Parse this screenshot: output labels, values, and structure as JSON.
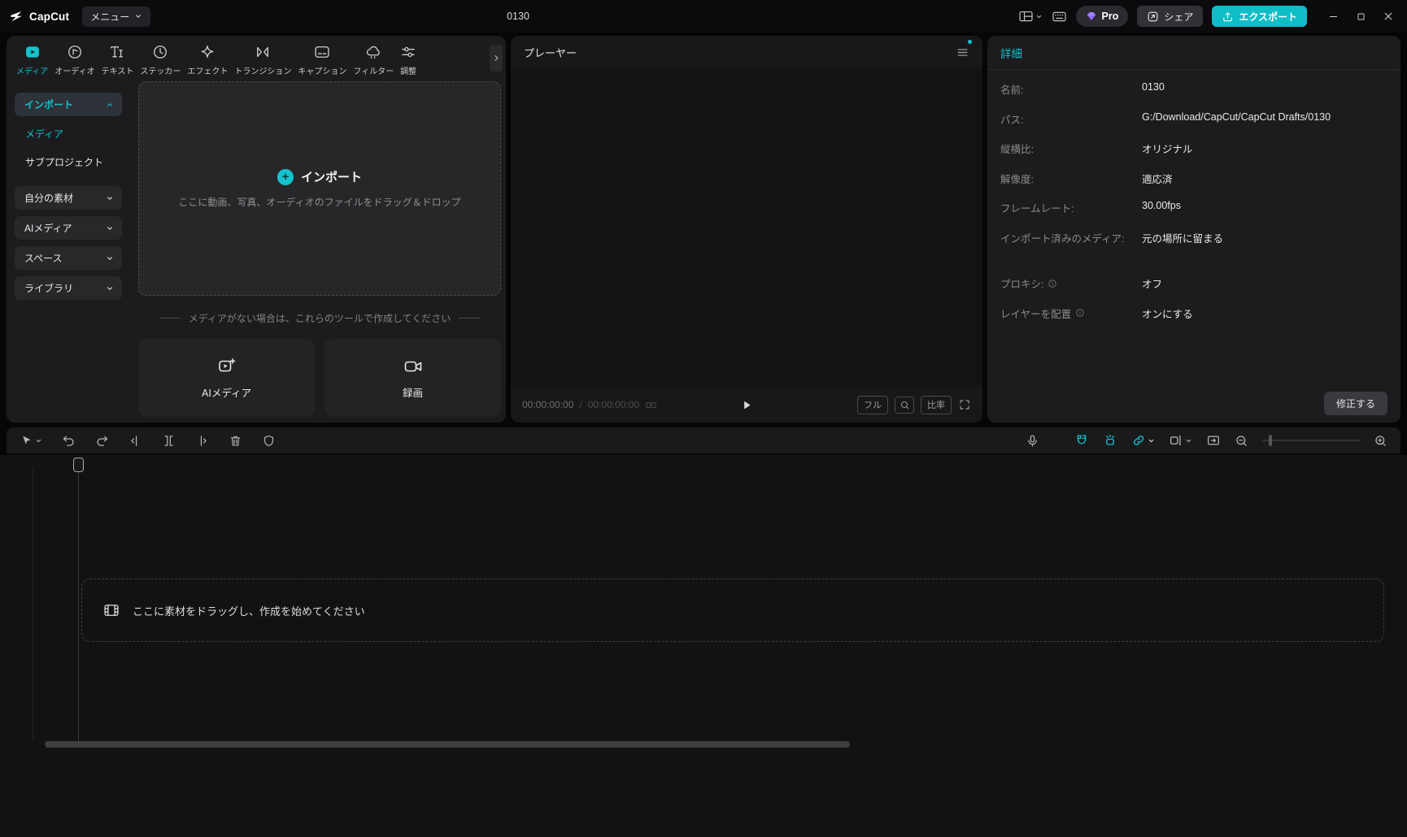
{
  "colors": {
    "accent": "#14c3cd",
    "pro_gem": "#8e6bff",
    "export_bg": "#0fbdc6"
  },
  "titlebar": {
    "app_name": "CapCut",
    "menu": "メニュー",
    "title": "0130",
    "pro": "Pro",
    "share": "シェア",
    "export": "エクスポート"
  },
  "media_panel": {
    "tabs": [
      {
        "label": "メディア"
      },
      {
        "label": "オーディオ"
      },
      {
        "label": "テキスト"
      },
      {
        "label": "ステッカー"
      },
      {
        "label": "エフェクト"
      },
      {
        "label": "トランジション"
      },
      {
        "label": "キャプション"
      },
      {
        "label": "フィルター"
      },
      {
        "label": "調整"
      }
    ],
    "sidebar": {
      "import": "インポート",
      "media": "メディア",
      "subproject": "サブプロジェクト",
      "groups": [
        {
          "label": "自分の素材"
        },
        {
          "label": "AIメディア"
        },
        {
          "label": "スペース"
        },
        {
          "label": "ライブラリ"
        }
      ]
    },
    "dropzone": {
      "title": "インポート",
      "hint": "ここに動画、写真、オーディオのファイルをドラッグ＆ドロップ"
    },
    "tools_hint": "メディアがない場合は、これらのツールで作成してください",
    "cards": [
      {
        "label": "AIメディア"
      },
      {
        "label": "録画"
      }
    ]
  },
  "player": {
    "title": "プレーヤー",
    "time_current": "00:00:00:00",
    "time_separator": "/",
    "time_total": "00:00:00:00",
    "full": "フル",
    "ratio": "比率"
  },
  "details": {
    "title": "詳細",
    "fields": [
      {
        "label": "名前:",
        "value": "0130"
      },
      {
        "label": "パス:",
        "value": "G:/Download/CapCut/CapCut Drafts/0130"
      },
      {
        "label": "縦横比:",
        "value": "オリジナル"
      },
      {
        "label": "解像度:",
        "value": "適応済"
      },
      {
        "label": "フレームレート:",
        "value": "30.00fps"
      },
      {
        "label": "インポート済みのメディア:",
        "value": "元の場所に留まる"
      }
    ],
    "proxy": {
      "label": "プロキシ:",
      "value": "オフ"
    },
    "layer": {
      "label": "レイヤーを配置",
      "value": "オンにする"
    },
    "modify": "修正する"
  },
  "timeline": {
    "hint": "ここに素材をドラッグし、作成を始めてください"
  }
}
